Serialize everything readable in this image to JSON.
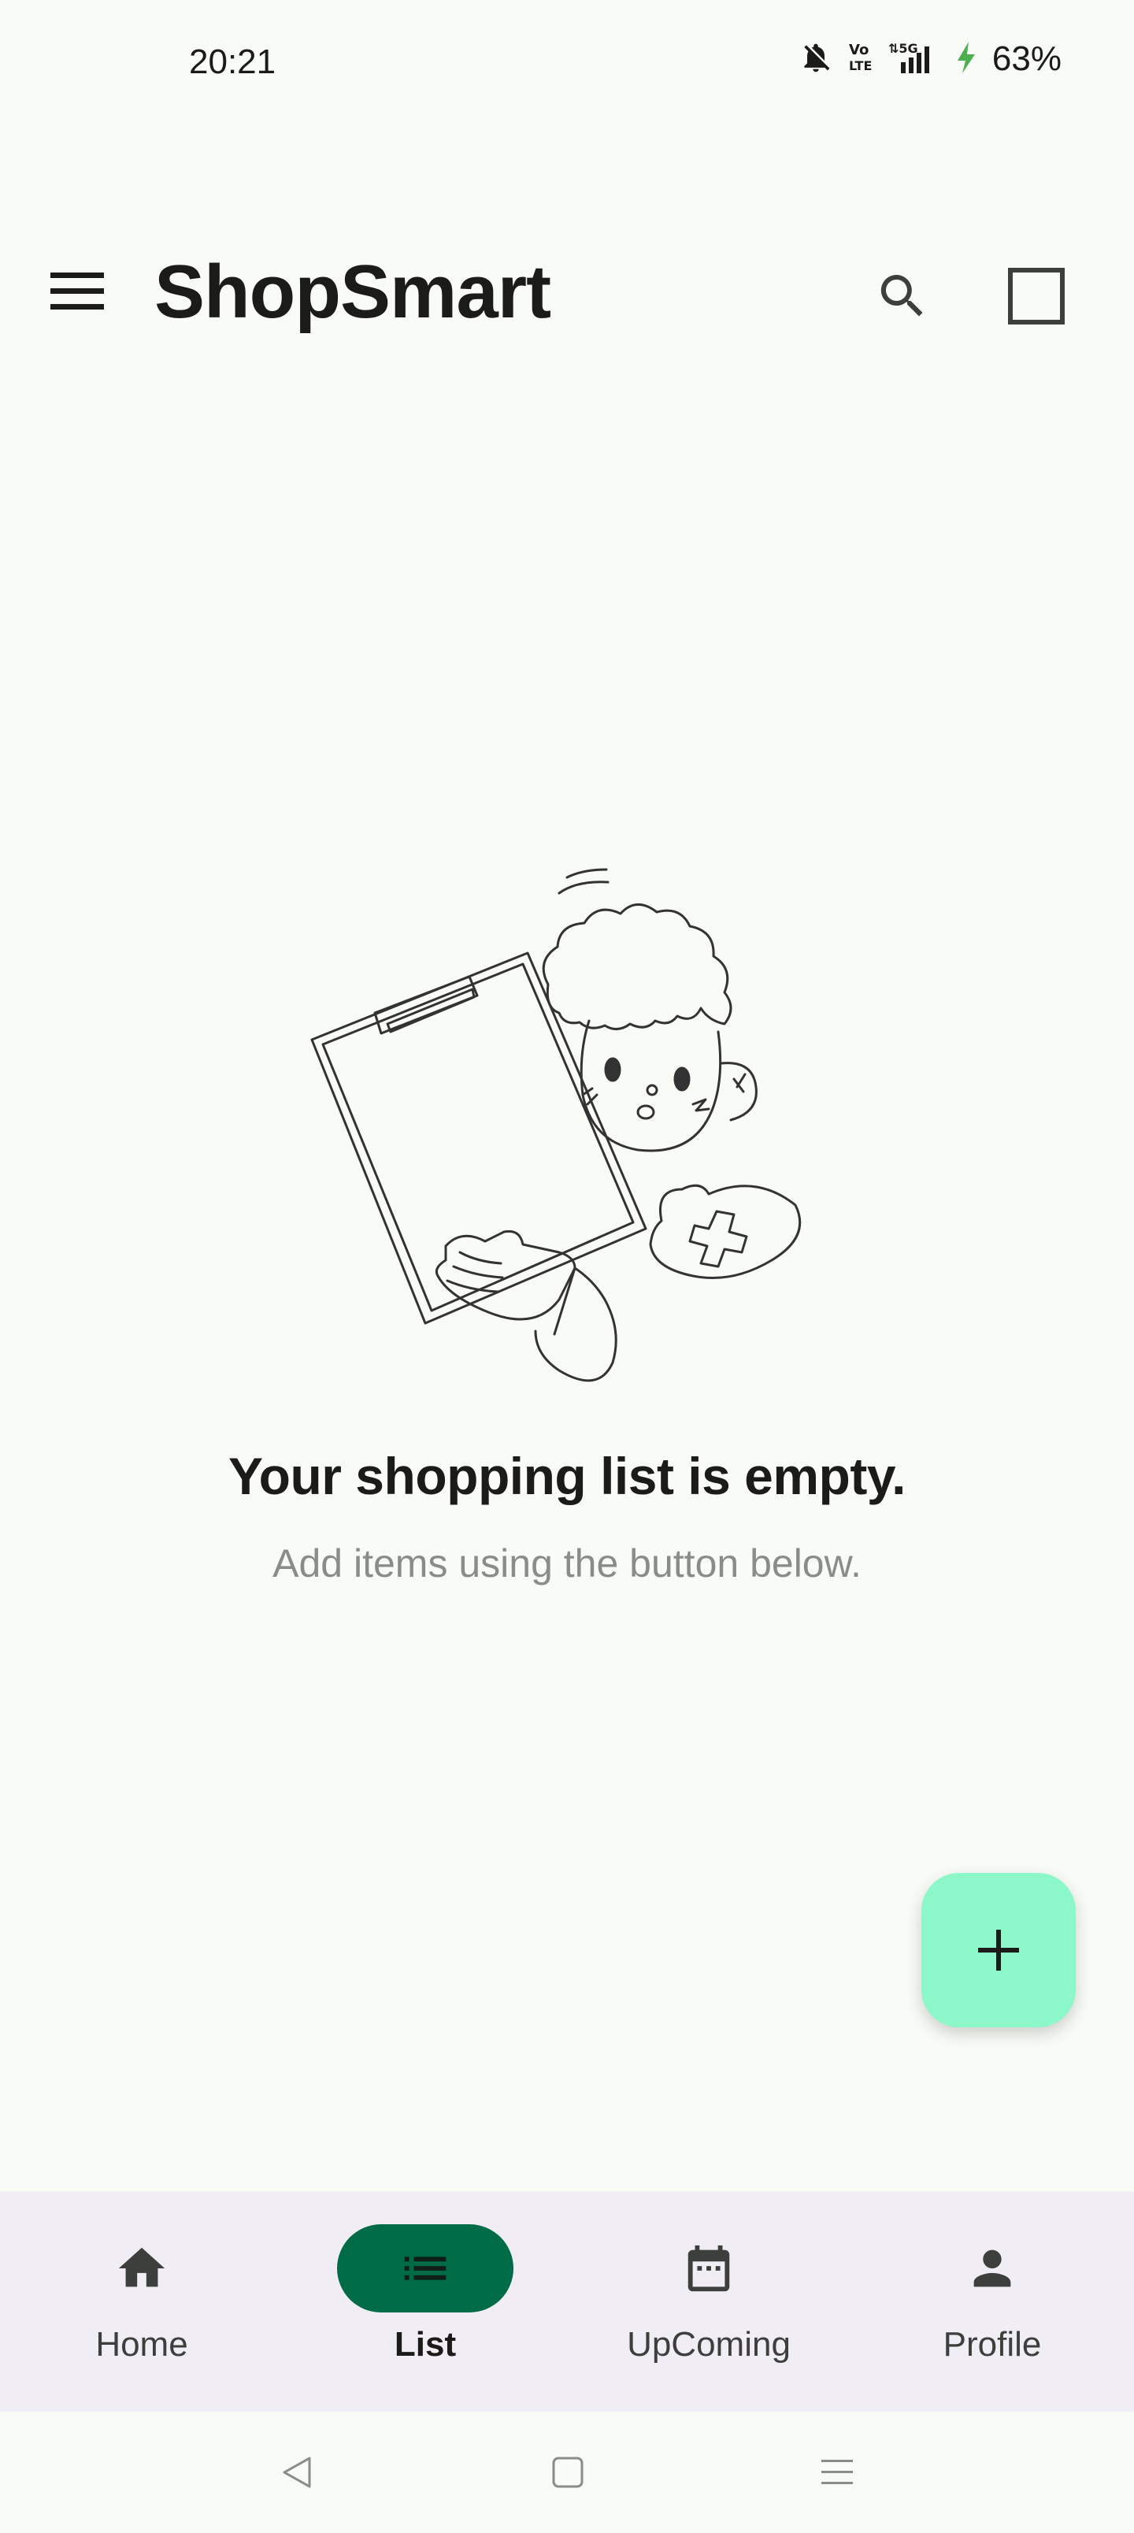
{
  "status_bar": {
    "time": "20:21",
    "battery": "63%",
    "icons": [
      "bell-off-icon",
      "volte-icon",
      "5g-signal-icon",
      "charging-icon"
    ]
  },
  "app_bar": {
    "title": "ShopSmart",
    "icons": [
      "menu-icon",
      "search-icon",
      "square-icon"
    ]
  },
  "empty_state": {
    "title": "Your shopping list is empty.",
    "subtitle": "Add items using the  button below.",
    "illustration": "person-holding-clipboard-illustration"
  },
  "fab": {
    "icon": "plus-icon",
    "color": "#8cf7c9"
  },
  "bottom_nav": {
    "items": [
      {
        "label": "Home",
        "icon": "home-icon",
        "active": false
      },
      {
        "label": "List",
        "icon": "list-icon",
        "active": true
      },
      {
        "label": "UpComing",
        "icon": "calendar-icon",
        "active": false
      },
      {
        "label": "Profile",
        "icon": "person-icon",
        "active": false
      }
    ],
    "active_color": "#006b47",
    "background": "#f1edf5"
  },
  "system_nav": {
    "icons": [
      "back-icon",
      "home-square-icon",
      "recents-icon"
    ]
  }
}
